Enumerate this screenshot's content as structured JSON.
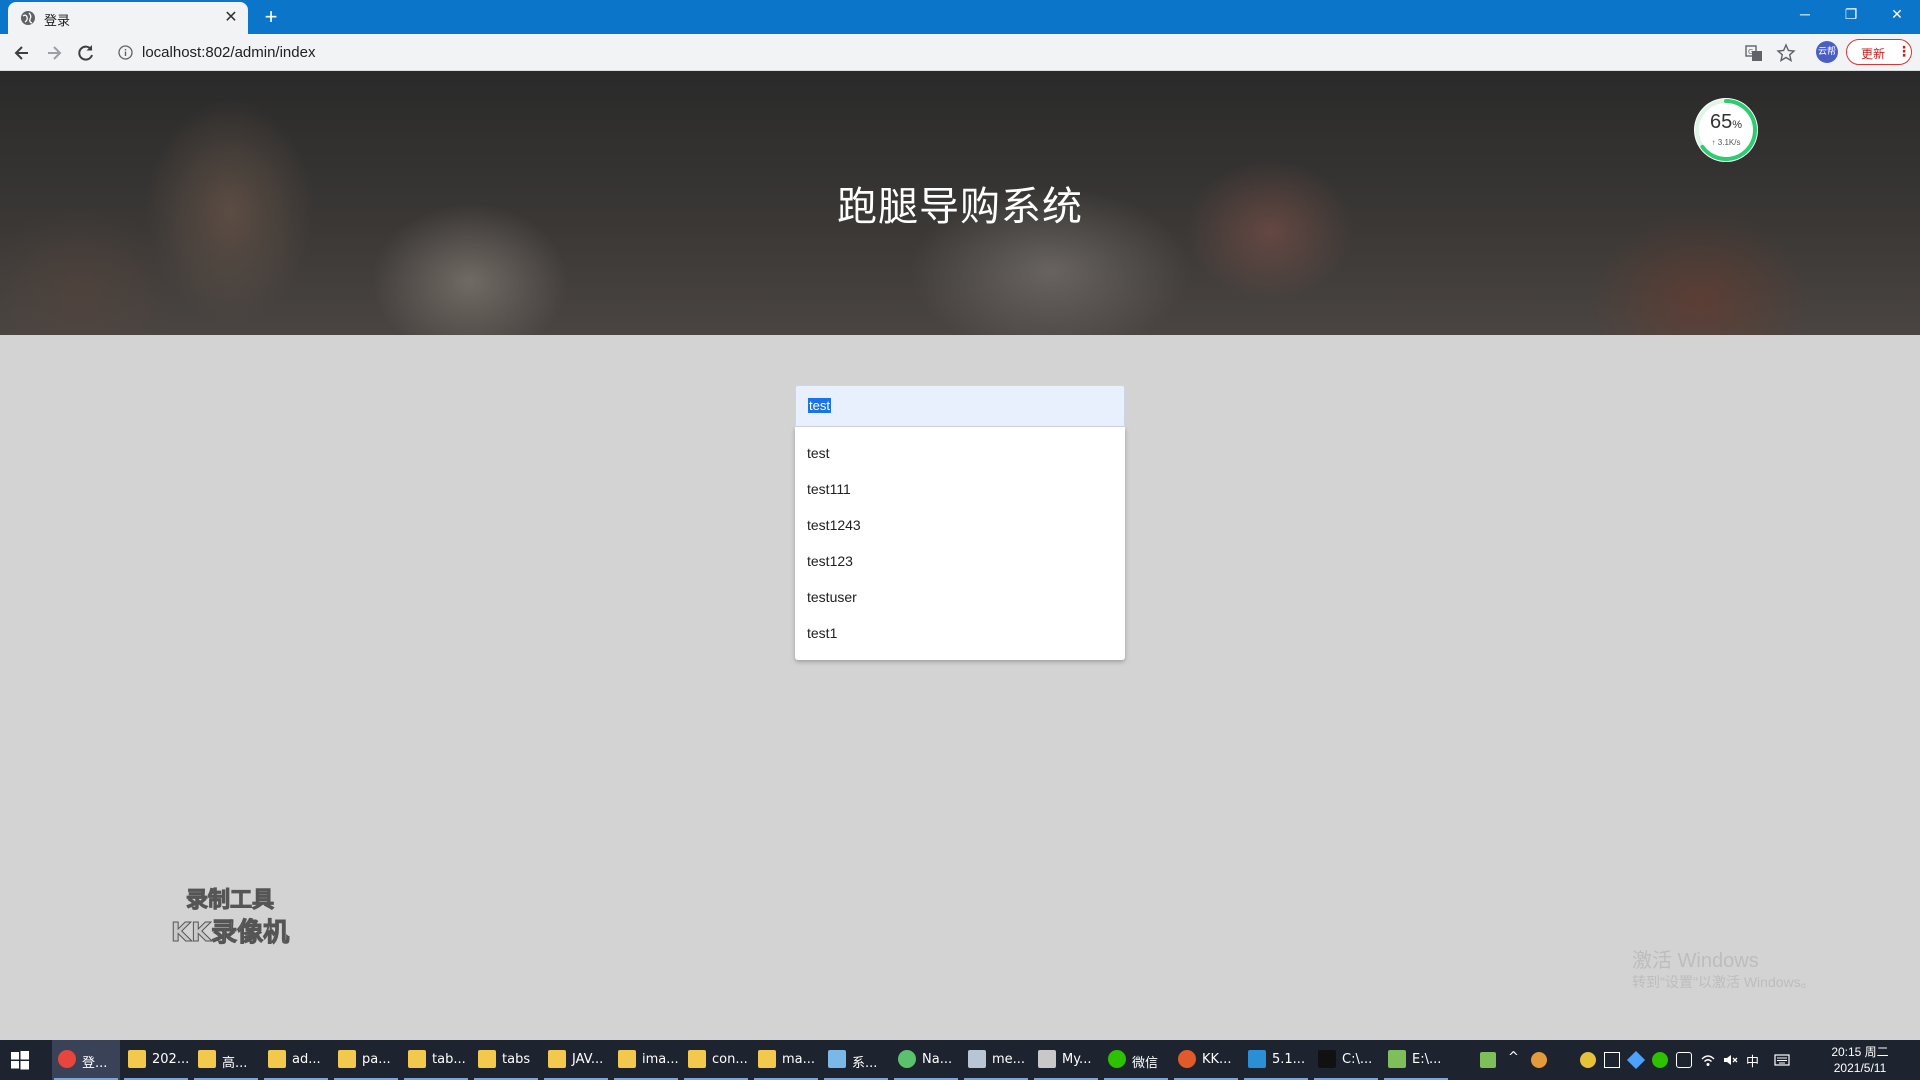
{
  "browser": {
    "tab": {
      "title": "登录",
      "close": "✕",
      "favicon": "globe-icon"
    },
    "new_tab": "+",
    "window_controls": {
      "minimize": "─",
      "restore": "❐",
      "close": "✕"
    },
    "url": "localhost:802/admin/index",
    "profile_label": "云帮",
    "update_label": "更新",
    "update_menu": "⋮"
  },
  "page": {
    "title": "跑腿导购系统",
    "gauge": {
      "percent": 65,
      "percent_label": "65",
      "unit": "%",
      "speed": "↑ 3.1K/s",
      "ring_color": "#2ecc71"
    },
    "search": {
      "value": "test",
      "suggestions": [
        "test",
        "test111",
        "test1243",
        "test123",
        "testuser",
        "test1"
      ]
    }
  },
  "overlays": {
    "kk_line1": "录制工具",
    "kk_line2": "KK录像机",
    "windows_activate_1": "激活 Windows",
    "windows_activate_2": "转到\"设置\"以激活 Windows。"
  },
  "taskbar": {
    "items": [
      {
        "label": "登...",
        "icon": "chrome-icon",
        "color": "#e8453c",
        "active": true
      },
      {
        "label": "202...",
        "icon": "folder-icon",
        "color": "#f2c94c"
      },
      {
        "label": "高...",
        "icon": "folder-icon",
        "color": "#f2c94c"
      },
      {
        "label": "ad...",
        "icon": "folder-icon",
        "color": "#f2c94c"
      },
      {
        "label": "pa...",
        "icon": "folder-icon",
        "color": "#f2c94c"
      },
      {
        "label": "tab...",
        "icon": "folder-icon",
        "color": "#f2c94c"
      },
      {
        "label": "tabs",
        "icon": "folder-icon",
        "color": "#f2c94c"
      },
      {
        "label": "JAV...",
        "icon": "folder-icon",
        "color": "#f2c94c"
      },
      {
        "label": "ima...",
        "icon": "folder-icon",
        "color": "#f2c94c"
      },
      {
        "label": "con...",
        "icon": "folder-icon",
        "color": "#f2c94c"
      },
      {
        "label": "ma...",
        "icon": "folder-icon",
        "color": "#f2c94c"
      },
      {
        "label": "系...",
        "icon": "ship-icon",
        "color": "#7ab8e8"
      },
      {
        "label": "Na...",
        "icon": "navicat-icon",
        "color": "#5cc16c"
      },
      {
        "label": "me...",
        "icon": "home-icon",
        "color": "#b9c4d4"
      },
      {
        "label": "My...",
        "icon": "feather-icon",
        "color": "#c8c8c8"
      },
      {
        "label": "微信",
        "icon": "wechat-icon",
        "color": "#2dc100"
      },
      {
        "label": "KK...",
        "icon": "kk-recorder-icon",
        "color": "#e05a2a"
      },
      {
        "label": "5.1...",
        "icon": "vscode-icon",
        "color": "#2b8fd6"
      },
      {
        "label": "C:\\...",
        "icon": "terminal-icon",
        "color": "#111111"
      },
      {
        "label": "E:\\...",
        "icon": "notepad-icon",
        "color": "#7fbf5a"
      }
    ],
    "tray_ime": "中",
    "time": "20:15 周二",
    "date": "2021/5/11"
  }
}
